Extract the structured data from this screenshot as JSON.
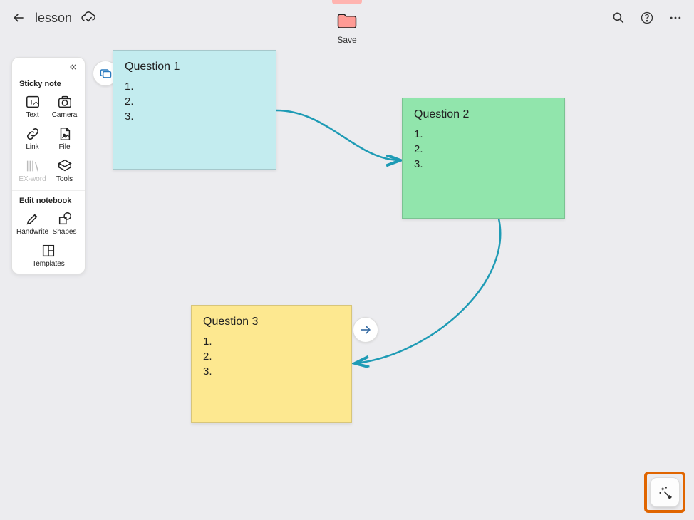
{
  "header": {
    "title": "lesson"
  },
  "save": {
    "label": "Save"
  },
  "sidebar": {
    "section1_label": "Sticky note",
    "section2_label": "Edit notebook",
    "items": {
      "text": "Text",
      "camera": "Camera",
      "link": "Link",
      "file": "File",
      "exword": "EX-word",
      "tools": "Tools",
      "handwrite": "Handwrite",
      "shapes": "Shapes",
      "templates": "Templates"
    }
  },
  "notes": {
    "n1": {
      "title": "Question 1",
      "line1": "1.",
      "line2": "2.",
      "line3": "3."
    },
    "n2": {
      "title": "Question 2",
      "line1": "1.",
      "line2": "2.",
      "line3": "3."
    },
    "n3": {
      "title": "Question 3",
      "line1": "1.",
      "line2": "2.",
      "line3": "3."
    }
  }
}
